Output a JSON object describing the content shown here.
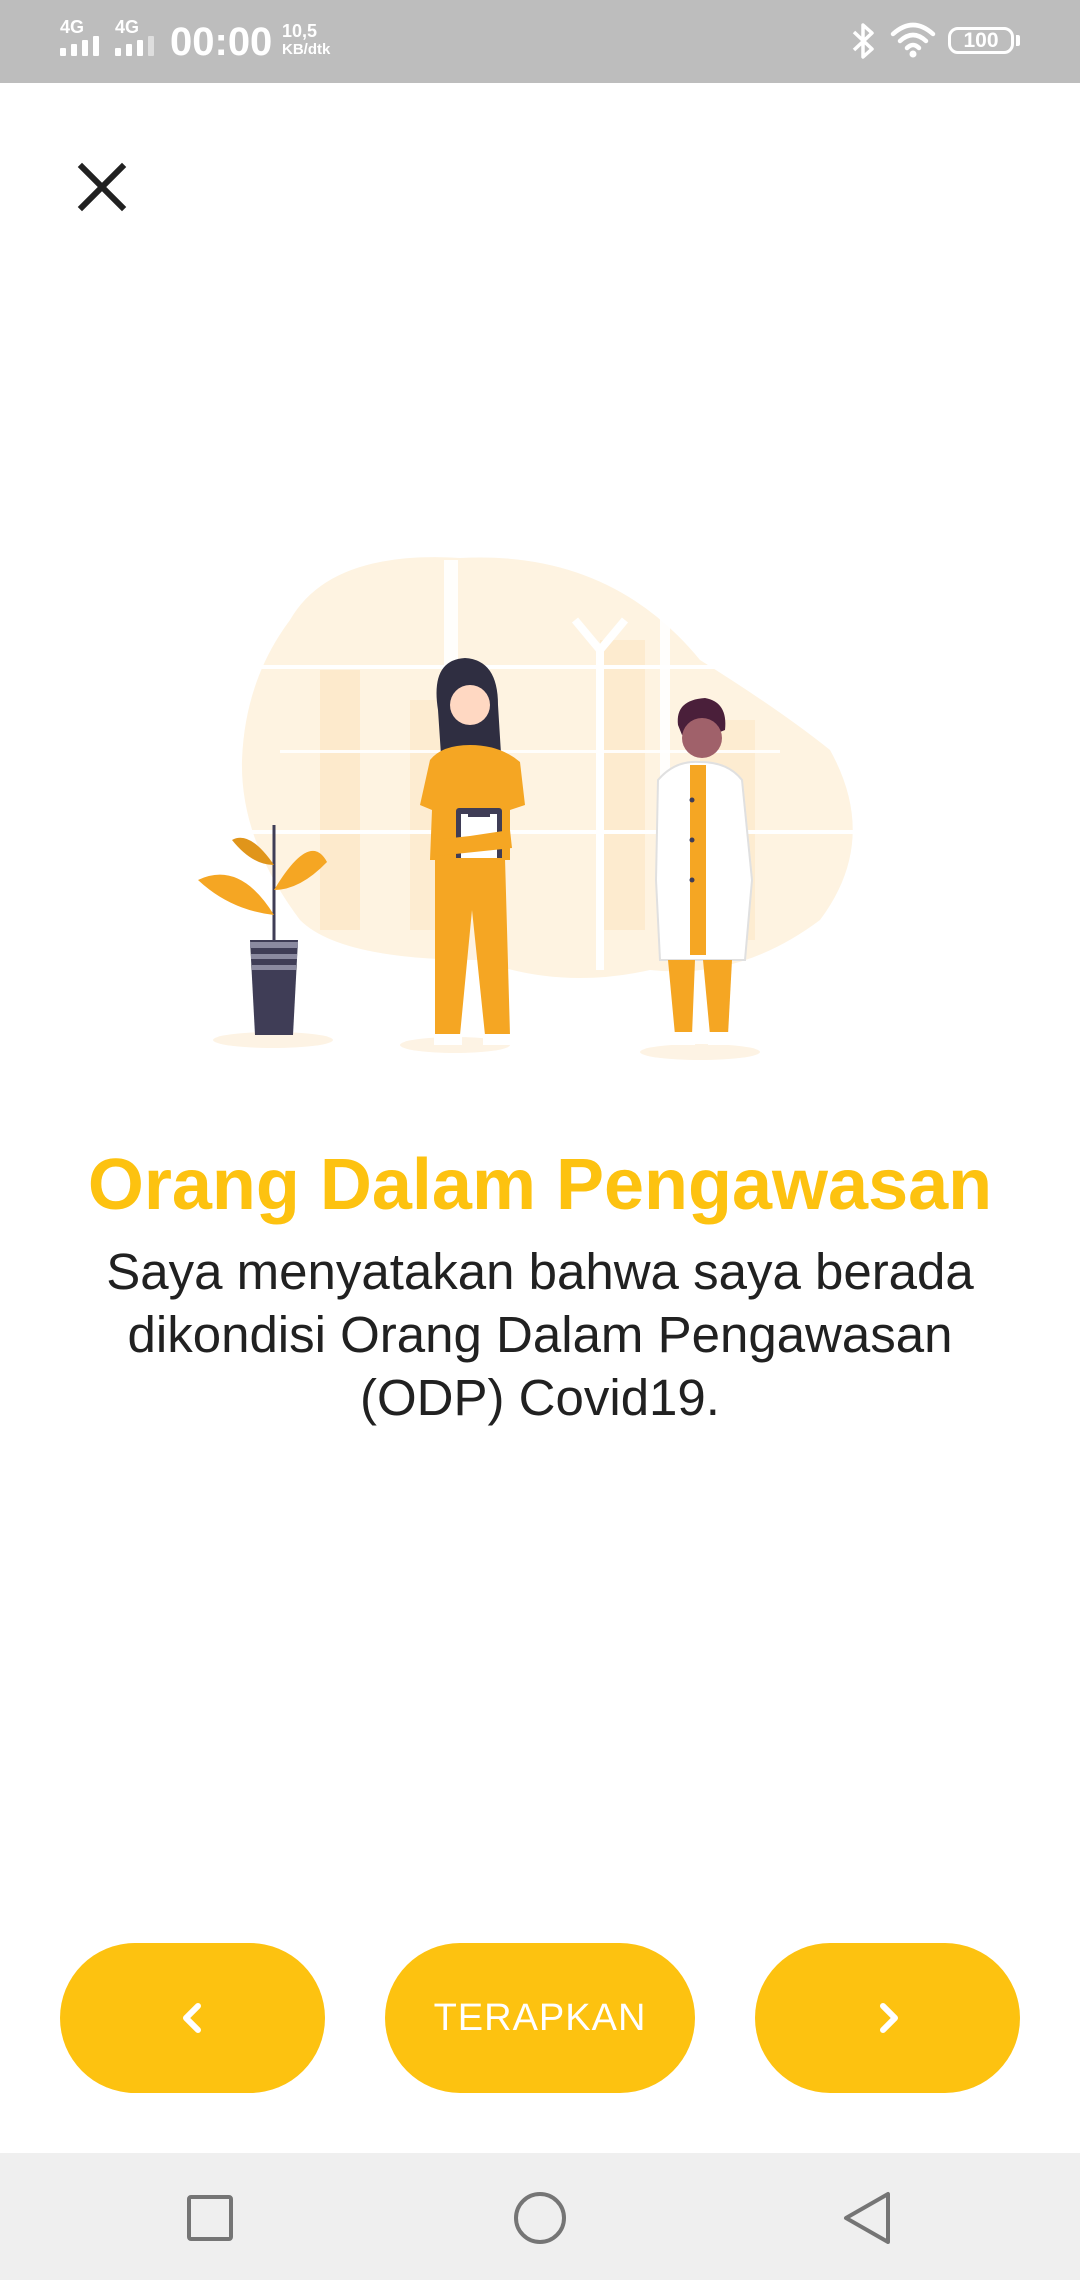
{
  "status_bar": {
    "network_1": "4G",
    "network_2": "4G",
    "time": "00:00",
    "speed_value": "10,5",
    "speed_unit": "KB/dtk",
    "battery": "100"
  },
  "icons": {
    "close": "close-icon",
    "prev": "chevron-left-icon",
    "next": "chevron-right-icon",
    "recent": "square-recents-icon",
    "home": "circle-home-icon",
    "back": "triangle-back-icon"
  },
  "content": {
    "title": "Orang Dalam Pengawasan",
    "description": "Saya menyatakan bahwa saya berada dikondisi Orang Dalam Pengawasan (ODP) Covid19."
  },
  "buttons": {
    "apply_label": "TERAPKAN"
  },
  "colors": {
    "accent": "#fdc210",
    "status_bar": "#bdbdbd",
    "nav_bar": "#efefef",
    "text": "#212121"
  }
}
